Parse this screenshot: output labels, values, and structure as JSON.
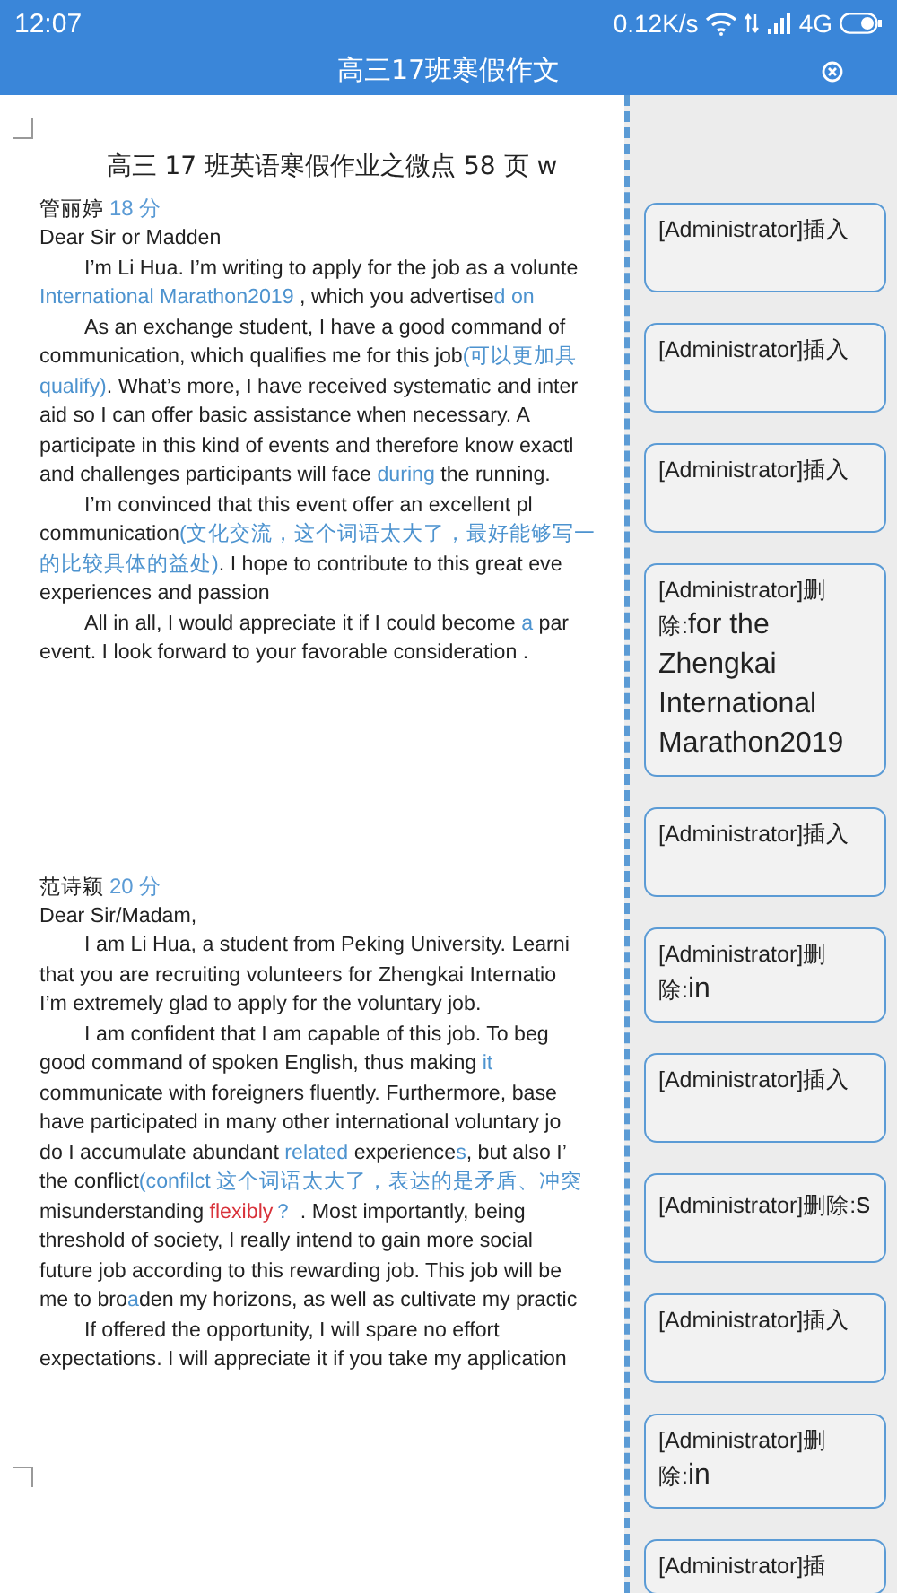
{
  "status_bar": {
    "time": "12:07",
    "speed": "0.12K/s",
    "network": "4G"
  },
  "title_bar": {
    "title": "高三17班寒假作文"
  },
  "document": {
    "heading": "高三 17 班英语寒假作业之微点 58 页 w",
    "sections": [
      {
        "author": "管丽婷",
        "score": "18 分",
        "lines": [
          {
            "indent": false,
            "segments": [
              {
                "kind": "text",
                "text": "Dear Sir or Madden"
              }
            ]
          },
          {
            "indent": true,
            "segments": [
              {
                "kind": "text",
                "text": "I’m Li Hua. I’m writing to apply for the job as a volunte"
              }
            ]
          },
          {
            "indent": false,
            "segments": [
              {
                "kind": "insert",
                "text": "International Marathon2019"
              },
              {
                "kind": "text",
                "text": "  , which you advertise"
              },
              {
                "kind": "insert",
                "text": "d  on"
              }
            ]
          },
          {
            "indent": true,
            "segments": [
              {
                "kind": "text",
                "text": "As an exchange student, I have a good command of"
              }
            ]
          },
          {
            "indent": false,
            "segments": [
              {
                "kind": "text",
                "text": "communication, which qualifies me for this job"
              },
              {
                "kind": "insert",
                "text": "(可以更加具"
              }
            ]
          },
          {
            "indent": false,
            "segments": [
              {
                "kind": "insert",
                "text": "qualify)"
              },
              {
                "kind": "text",
                "text": ". What’s more, I have received systematic and inter"
              }
            ]
          },
          {
            "indent": false,
            "segments": [
              {
                "kind": "text",
                "text": "aid so I can offer basic assistance when necessary. A"
              }
            ]
          },
          {
            "indent": false,
            "segments": [
              {
                "kind": "text",
                "text": "participate in this kind of events and therefore know exactl"
              }
            ]
          },
          {
            "indent": false,
            "segments": [
              {
                "kind": "text",
                "text": "and challenges participants will face "
              },
              {
                "kind": "insert",
                "text": "during"
              },
              {
                "kind": "text",
                "text": " the running."
              }
            ]
          },
          {
            "indent": true,
            "segments": [
              {
                "kind": "text",
                "text": "I’m convinced that this event offer an excellent pl"
              }
            ]
          },
          {
            "indent": false,
            "segments": [
              {
                "kind": "text",
                "text": "communication"
              },
              {
                "kind": "insert",
                "text": "(文化交流，这个词语太大了，最好能够写一"
              }
            ]
          },
          {
            "indent": false,
            "segments": [
              {
                "kind": "insert",
                "text": "的比较具体的益处)"
              },
              {
                "kind": "text",
                "text": ". I hope to contribute to this great eve"
              }
            ]
          },
          {
            "indent": false,
            "segments": [
              {
                "kind": "text",
                "text": "experiences and passion"
              }
            ]
          },
          {
            "indent": true,
            "segments": [
              {
                "kind": "text",
                "text": "All in all, I would appreciate it if I could become "
              },
              {
                "kind": "insert",
                "text": "a"
              },
              {
                "kind": "text",
                "text": " par"
              }
            ]
          },
          {
            "indent": false,
            "segments": [
              {
                "kind": "text",
                "text": "event. I look forward to your favorable consideration ."
              }
            ]
          }
        ]
      },
      {
        "author": "范诗颖",
        "score": "20 分",
        "lines": [
          {
            "indent": false,
            "segments": [
              {
                "kind": "text",
                "text": "Dear Sir/Madam,"
              }
            ]
          },
          {
            "indent": true,
            "segments": [
              {
                "kind": "text",
                "text": "I am Li Hua, a student from Peking University. Learni"
              }
            ]
          },
          {
            "indent": false,
            "segments": [
              {
                "kind": "text",
                "text": "that you are recruiting volunteers for Zhengkai Internatio"
              }
            ]
          },
          {
            "indent": false,
            "segments": [
              {
                "kind": "text",
                "text": "I’m extremely glad to apply for the voluntary job."
              }
            ]
          },
          {
            "indent": true,
            "segments": [
              {
                "kind": "text",
                "text": "I am confident that I am capable of this job. To beg"
              }
            ]
          },
          {
            "indent": false,
            "segments": [
              {
                "kind": "text",
                "text": "good command of spoken English, thus making "
              },
              {
                "kind": "insert",
                "text": "it"
              }
            ]
          },
          {
            "indent": false,
            "segments": [
              {
                "kind": "text",
                "text": "communicate with foreigners fluently. Furthermore, base"
              }
            ]
          },
          {
            "indent": false,
            "segments": [
              {
                "kind": "text",
                "text": "have participated in many other international voluntary jo"
              }
            ]
          },
          {
            "indent": false,
            "segments": [
              {
                "kind": "text",
                "text": "do I accumulate abundant "
              },
              {
                "kind": "insert",
                "text": "related"
              },
              {
                "kind": "text",
                "text": " experience"
              },
              {
                "kind": "insert",
                "text": "s"
              },
              {
                "kind": "text",
                "text": ", but also I’"
              }
            ]
          },
          {
            "indent": false,
            "segments": [
              {
                "kind": "text",
                "text": "the conflict"
              },
              {
                "kind": "insert",
                "text": "(confilct 这个词语太大了，表达的是矛盾、冲突"
              }
            ]
          },
          {
            "indent": false,
            "segments": [
              {
                "kind": "text",
                "text": "misunderstanding "
              },
              {
                "kind": "delete",
                "text": "flexibly"
              },
              {
                "kind": "insert",
                "text": "？"
              },
              {
                "kind": "text",
                "text": " . Most importantly,   being"
              }
            ]
          },
          {
            "indent": false,
            "segments": [
              {
                "kind": "text",
                "text": "threshold of society, I really intend to gain more social"
              }
            ]
          },
          {
            "indent": false,
            "segments": [
              {
                "kind": "text",
                "text": "future job according to this rewarding job. This job will be"
              }
            ]
          },
          {
            "indent": false,
            "segments": [
              {
                "kind": "text",
                "text": "me to bro"
              },
              {
                "kind": "insert",
                "text": "a"
              },
              {
                "kind": "text",
                "text": "den my horizons, as well as cultivate my practic"
              }
            ]
          },
          {
            "indent": true,
            "segments": [
              {
                "kind": "text",
                "text": "If offered the opportunity, I will spare no effort"
              }
            ]
          },
          {
            "indent": false,
            "segments": [
              {
                "kind": "text",
                "text": "expectations. I will appreciate it if you take my application"
              }
            ]
          }
        ]
      }
    ]
  },
  "comments": [
    {
      "author": "[Administrator]",
      "action": "插入"
    },
    {
      "author": "[Administrator]",
      "action": "插入"
    },
    {
      "author": "[Administrator]",
      "action": "插入"
    },
    {
      "author": "[Administrator]",
      "action": "删除:",
      "content": "for the Zhengkai International Marathon2019"
    },
    {
      "author": "[Administrator]",
      "action": "插入"
    },
    {
      "author": "[Administrator]",
      "action": "删除:",
      "content": "in"
    },
    {
      "author": "[Administrator]",
      "action": "插入"
    },
    {
      "author": "[Administrator]",
      "action": "删除:",
      "content": "s"
    },
    {
      "author": "[Administrator]",
      "action": "插入"
    },
    {
      "author": "[Administrator]",
      "action": "删除:",
      "content": "in"
    },
    {
      "author": "[Administrator]",
      "action": "插"
    }
  ]
}
